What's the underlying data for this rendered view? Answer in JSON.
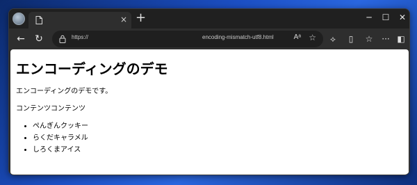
{
  "browser": {
    "tab": {
      "title": "",
      "close": "×"
    },
    "new_tab": "+",
    "window_controls": {
      "minimize": "─",
      "maximize": "☐",
      "close": "✕"
    },
    "address": {
      "scheme": "https://",
      "path": "encoding-mismatch-utf8.html",
      "read_aloud": "Aᵃ"
    }
  },
  "page": {
    "heading": "エンコーディングのデモ",
    "intro": "エンコーディングのデモです。",
    "content": "コンテンツコンテンツ",
    "items": [
      "ぺんぎんクッキー",
      "らくだキャラメル",
      "しろくまアイス"
    ]
  }
}
